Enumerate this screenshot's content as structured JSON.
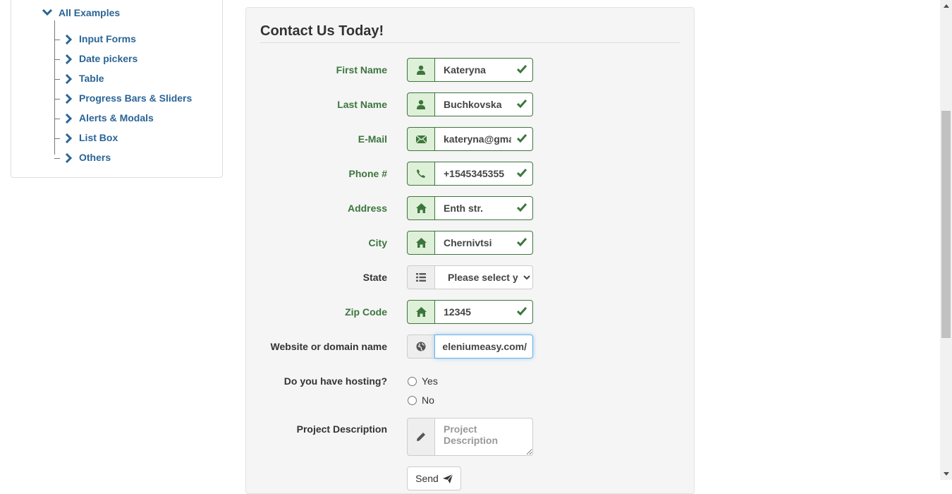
{
  "sidebar": {
    "root_label": "All Examples",
    "items": [
      {
        "label": "Input Forms"
      },
      {
        "label": "Date pickers"
      },
      {
        "label": "Table"
      },
      {
        "label": "Progress Bars & Sliders"
      },
      {
        "label": "Alerts & Modals"
      },
      {
        "label": "List Box"
      },
      {
        "label": "Others"
      }
    ]
  },
  "form": {
    "title": "Contact Us Today!",
    "fields": [
      {
        "label": "First Name",
        "value": "Kateryna",
        "icon": "user-icon",
        "valid": true
      },
      {
        "label": "Last Name",
        "value": "Buchkovska",
        "icon": "user-icon",
        "valid": true
      },
      {
        "label": "E-Mail",
        "value": "kateryna@gmail.com",
        "icon": "envelope-icon",
        "valid": true
      },
      {
        "label": "Phone #",
        "value": "+1545345355",
        "icon": "phone-icon",
        "valid": true
      },
      {
        "label": "Address",
        "value": "Enth str.",
        "icon": "home-icon",
        "valid": true
      },
      {
        "label": "City",
        "value": "Chernivtsi",
        "icon": "home-icon",
        "valid": true
      },
      {
        "label": "State",
        "value": "Please select your state",
        "icon": "list-icon",
        "valid": false
      },
      {
        "label": "Zip Code",
        "value": "12345",
        "icon": "home-icon",
        "valid": true
      },
      {
        "label": "Website or domain name",
        "value": "eleniumeasy.com/",
        "icon": "globe-icon",
        "valid": false
      }
    ],
    "hosting": {
      "label": "Do you have hosting?",
      "options": [
        "Yes",
        "No"
      ]
    },
    "description": {
      "label": "Project Description",
      "placeholder": "Project Description",
      "icon": "pencil-icon"
    },
    "send_label": "Send"
  },
  "colors": {
    "success": "#3c763d",
    "success_bg": "#dff0d8",
    "link": "#2a6496",
    "focus": "#66afe9"
  }
}
